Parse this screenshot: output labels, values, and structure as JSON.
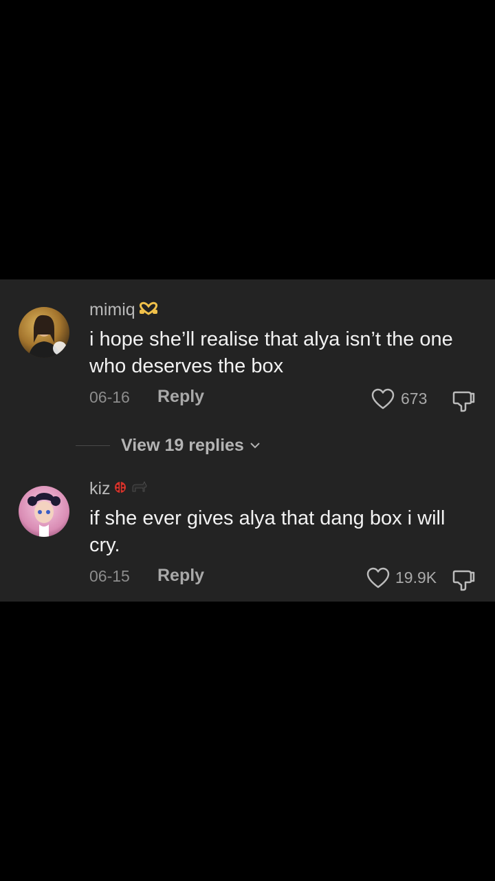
{
  "comments": [
    {
      "username": "mimiq",
      "username_emoji": "heart-hands-emoji",
      "text": "i hope she’ll realise that alya isn’t the one who deserves the box",
      "date": "06-16",
      "reply_label": "Reply",
      "likes": "673"
    },
    {
      "username": "kiz",
      "username_emoji": "ladybug-and-cat-emoji",
      "text": "if she ever gives alya that dang box i will cry.",
      "date": "06-15",
      "reply_label": "Reply",
      "likes": "19.9K"
    }
  ],
  "view_replies": {
    "label": "View 19 replies"
  },
  "colors": {
    "panel_bg": "#232323",
    "background": "#000000",
    "username": "#b9b9b9",
    "comment_text": "#f2f2f2",
    "meta": "#8d8d8d"
  }
}
